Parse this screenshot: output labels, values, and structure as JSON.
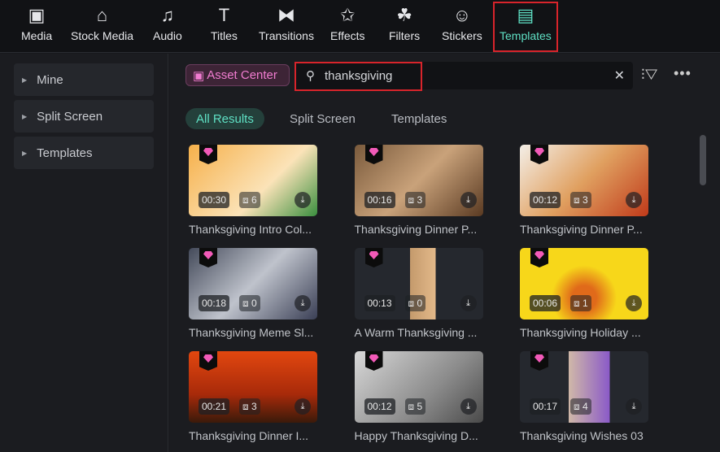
{
  "tabs": [
    {
      "label": "Media",
      "icon": "media-icon"
    },
    {
      "label": "Stock Media",
      "icon": "stock-media-icon"
    },
    {
      "label": "Audio",
      "icon": "audio-icon"
    },
    {
      "label": "Titles",
      "icon": "titles-icon"
    },
    {
      "label": "Transitions",
      "icon": "transitions-icon"
    },
    {
      "label": "Effects",
      "icon": "effects-icon"
    },
    {
      "label": "Filters",
      "icon": "filters-icon"
    },
    {
      "label": "Stickers",
      "icon": "stickers-icon"
    },
    {
      "label": "Templates",
      "icon": "templates-icon",
      "active": true
    }
  ],
  "sidebar": {
    "items": [
      {
        "label": "Mine"
      },
      {
        "label": "Split Screen"
      },
      {
        "label": "Templates"
      }
    ]
  },
  "asset_center": "Asset Center",
  "search": {
    "value": "thanksgiving"
  },
  "filters": [
    "All Results",
    "Split Screen",
    "Templates"
  ],
  "cards": [
    {
      "title": "Thanksgiving Intro Col...",
      "duration": "00:30",
      "count": "6",
      "bg": "linear-gradient(135deg,#f6b04a,#fbe3b8 60%,#3b8f3f)"
    },
    {
      "title": "Thanksgiving Dinner P...",
      "duration": "00:16",
      "count": "3",
      "bg": "linear-gradient(135deg,#7a5a3c,#c9a27a 50%,#5a3a22)"
    },
    {
      "title": "Thanksgiving Dinner P...",
      "duration": "00:12",
      "count": "3",
      "bg": "linear-gradient(135deg,#f4efe8,#e0a060 50%,#c03a1a)"
    },
    {
      "title": "Thanksgiving Meme Sl...",
      "duration": "00:18",
      "count": "0",
      "bg": "linear-gradient(135deg,#444a5a,#bfc3cc 50%,#3a3f55)"
    },
    {
      "title": "A Warm Thanksgiving ...",
      "duration": "00:13",
      "count": "0",
      "bg": "linear-gradient(90deg,#25282e 43%,#c49a6c 43%,#e3b98a 63%,#25282e 63%)"
    },
    {
      "title": "Thanksgiving Holiday ...",
      "duration": "00:06",
      "count": "1",
      "bg": "radial-gradient(circle at 50% 70%,#e06a1a 15%,#f7d71a 40%)"
    },
    {
      "title": "Thanksgiving Dinner I...",
      "duration": "00:21",
      "count": "3",
      "bg": "linear-gradient(180deg,#e2470f,#a82a0a 60%,#3a1a0a)"
    },
    {
      "title": "Happy Thanksgiving D...",
      "duration": "00:12",
      "count": "5",
      "bg": "linear-gradient(135deg,#d8d8d8,#8a8a8a 60%,#4a4a4a)"
    },
    {
      "title": "Thanksgiving Wishes 03",
      "duration": "00:17",
      "count": "4",
      "bg": "linear-gradient(90deg,#25282e 38%,#d0b8a8 38%,#8a5ac8 70%,#25282e 70%)"
    }
  ]
}
